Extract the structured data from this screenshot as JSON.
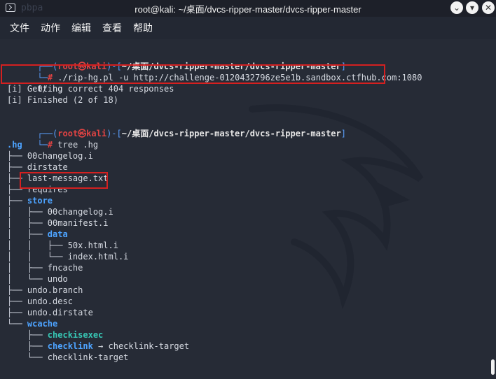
{
  "titlebar": {
    "ghost": "pbpa",
    "title": "root@kali: ~/桌面/dvcs-ripper-master/dvcs-ripper-master",
    "minimize": "⌄",
    "close": "✕"
  },
  "menu": [
    "文件",
    "动作",
    "编辑",
    "查看",
    "帮助"
  ],
  "session1": {
    "prompt_open": "┌──(",
    "user": "root㉿kali",
    "prompt_mid": ")-[",
    "path": "~/桌面/dvcs-ripper-master/dvcs-ripper-master",
    "prompt_close": "]",
    "prompt_hash_prefix": "└─",
    "hash": "# ",
    "command_line1": "./rip-hg.pl -u http://challenge-0120432796ze5e1b.sandbox.ctfhub.com:1080",
    "command_line2": "0/.hg",
    "output1": "[i] Getting correct 404 responses",
    "output2": "[i] Finished (2 of 18)"
  },
  "session2": {
    "prompt_open": "┌──(",
    "user": "root㉿kali",
    "prompt_mid": ")-[",
    "path": "~/桌面/dvcs-ripper-master/dvcs-ripper-master",
    "prompt_close": "]",
    "prompt_hash_prefix": "└─",
    "hash": "# ",
    "command": "tree .hg"
  },
  "tree": {
    "root": ".hg",
    "items": [
      {
        "prefix": "├── ",
        "name": "00changelog.i",
        "kind": "file"
      },
      {
        "prefix": "├── ",
        "name": "dirstate",
        "kind": "file"
      },
      {
        "prefix": "├── ",
        "name": "last-message.txt",
        "kind": "file"
      },
      {
        "prefix": "├── ",
        "name": "requires",
        "kind": "file"
      },
      {
        "prefix": "├── ",
        "name": "store",
        "kind": "dir"
      },
      {
        "prefix": "│   ├── ",
        "name": "00changelog.i",
        "kind": "file"
      },
      {
        "prefix": "│   ├── ",
        "name": "00manifest.i",
        "kind": "file"
      },
      {
        "prefix": "│   ├── ",
        "name": "data",
        "kind": "dir"
      },
      {
        "prefix": "│   │   ├── ",
        "name": "50x.html.i",
        "kind": "file"
      },
      {
        "prefix": "│   │   └── ",
        "name": "index.html.i",
        "kind": "file"
      },
      {
        "prefix": "│   ├── ",
        "name": "fncache",
        "kind": "file"
      },
      {
        "prefix": "│   └── ",
        "name": "undo",
        "kind": "file"
      },
      {
        "prefix": "├── ",
        "name": "undo.branch",
        "kind": "file"
      },
      {
        "prefix": "├── ",
        "name": "undo.desc",
        "kind": "file"
      },
      {
        "prefix": "├── ",
        "name": "undo.dirstate",
        "kind": "file"
      },
      {
        "prefix": "└── ",
        "name": "wcache",
        "kind": "dir"
      },
      {
        "prefix": "    ├── ",
        "name": "checkisexec",
        "kind": "special"
      },
      {
        "prefix": "    ├── ",
        "name": "checklink",
        "kind": "link",
        "target": " → checklink-target"
      },
      {
        "prefix": "    └── ",
        "name": "checklink-target",
        "kind": "file"
      }
    ]
  },
  "colors": {
    "background": "#262b36",
    "titlebar": "#1d2029",
    "highlight": "#d42020",
    "directory": "#4da3ff",
    "prompt_user": "#e04343"
  }
}
